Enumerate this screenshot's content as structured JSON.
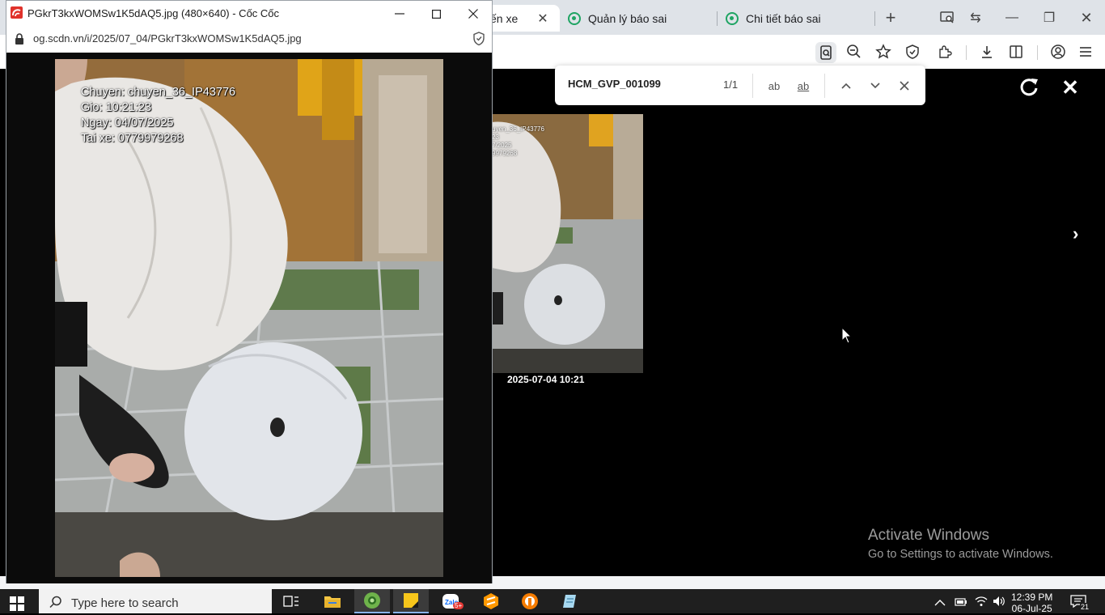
{
  "bg_browser": {
    "tabs": [
      {
        "label": "ến xe",
        "active": true
      },
      {
        "label": "Quản lý báo sai",
        "active": false
      },
      {
        "label": "Chi tiết báo sai",
        "active": false
      }
    ],
    "find": {
      "query": "HCM_GVP_001099",
      "count": "1/1",
      "case_label": "ab",
      "word_label": "ab"
    },
    "thumbnail": {
      "caption": "2025-07-04 10:21",
      "overlay_lines": [
        "uyen_36_IP43776",
        "23",
        "7/2025",
        "9979268"
      ]
    },
    "next_label": "›",
    "close_label": "✕",
    "watermark": {
      "line1": "Activate Windows",
      "line2": "Go to Settings to activate Windows."
    }
  },
  "popup": {
    "title": "PGkrT3kxWOMSw1K5dAQ5.jpg (480×640) - Cốc Cốc",
    "url": "og.scdn.vn/i/2025/07_04/PGkrT3kxWOMSw1K5dAQ5.jpg",
    "overlay": {
      "line1": "Chuyen: chuyen_36_IP43776",
      "line2": "Gio: 10:21:23",
      "line3": "Ngay: 04/07/2025",
      "line4": "Tai xe: 0779979268"
    }
  },
  "taskbar": {
    "search_placeholder": "Type here to search",
    "time": "12:39 PM",
    "date": "06-Jul-25",
    "zalo_badge": "5+",
    "notif_count": "21"
  },
  "colors": {
    "accent": "#1fa463",
    "coccoc_red": "#e0322b",
    "viewer_bg": "#000000"
  }
}
